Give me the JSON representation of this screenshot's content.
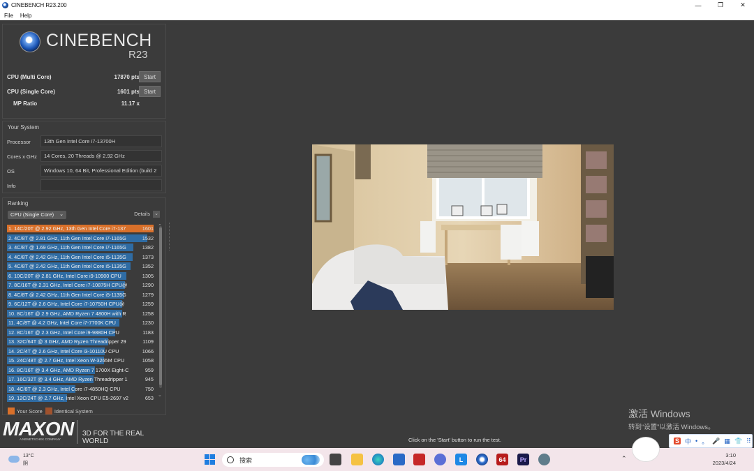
{
  "window": {
    "title": "CINEBENCH R23.200",
    "min": "—",
    "max": "❐",
    "close": "✕"
  },
  "menu": [
    "File",
    "Help"
  ],
  "logo": {
    "name": "CINEBENCH",
    "version": "R23"
  },
  "scores": {
    "multi": {
      "label": "CPU (Multi Core)",
      "value": "17870 pts",
      "button": "Start"
    },
    "single": {
      "label": "CPU (Single Core)",
      "value": "1601 pts",
      "button": "Start"
    },
    "mp": {
      "label": "MP Ratio",
      "value": "11.17 x"
    }
  },
  "system": {
    "title": "Your System",
    "rows": [
      {
        "key": "Processor",
        "value": "13th Gen Intel Core i7-13700H"
      },
      {
        "key": "Cores x GHz",
        "value": "14 Cores, 20 Threads @ 2.92 GHz"
      },
      {
        "key": "OS",
        "value": "Windows 10, 64 Bit, Professional Edition (build 2"
      },
      {
        "key": "Info",
        "value": ""
      }
    ]
  },
  "ranking": {
    "title": "Ranking",
    "select": "CPU (Single Core)",
    "details": "Details",
    "max_score": 1601,
    "items": [
      {
        "label": "1. 14C/20T @ 2.92 GHz, 13th Gen Intel Core i7-137",
        "score": 1601,
        "mine": true
      },
      {
        "label": "2. 4C/8T @ 2.81 GHz, 11th Gen Intel Core i7-1165G",
        "score": 1532,
        "mine": false
      },
      {
        "label": "3. 4C/8T @ 1.69 GHz, 11th Gen Intel Core i7-1165G",
        "score": 1382,
        "mine": false
      },
      {
        "label": "4. 4C/8T @ 2.42 GHz, 11th Gen Intel Core i5-1135G",
        "score": 1373,
        "mine": false
      },
      {
        "label": "5. 4C/8T @ 2.42 GHz, 11th Gen Intel Core i5-1135G",
        "score": 1352,
        "mine": false
      },
      {
        "label": "6. 10C/20T @ 2.81 GHz, Intel Core i9-10900 CPU",
        "score": 1305,
        "mine": false
      },
      {
        "label": "7. 8C/16T @ 2.31 GHz, Intel Core i7-10875H CPU@",
        "score": 1290,
        "mine": false
      },
      {
        "label": "8. 4C/8T @ 2.42 GHz, 11th Gen Intel Core i5-1135G",
        "score": 1279,
        "mine": false
      },
      {
        "label": "9. 6C/12T @ 2.6 GHz, Intel Core i7-10750H CPU@",
        "score": 1259,
        "mine": false
      },
      {
        "label": "10. 8C/16T @ 2.9 GHz, AMD Ryzen 7 4800H with R",
        "score": 1258,
        "mine": false
      },
      {
        "label": "11. 4C/8T @ 4.2 GHz, Intel Core i7-7700K CPU",
        "score": 1230,
        "mine": false
      },
      {
        "label": "12. 8C/16T @ 2.3 GHz, Intel Core i9-9880H CPU",
        "score": 1183,
        "mine": false
      },
      {
        "label": "13. 32C/64T @ 3 GHz, AMD Ryzen Threadripper 29",
        "score": 1109,
        "mine": false
      },
      {
        "label": "14. 2C/4T @ 2.6 GHz, Intel Core i3-10110U CPU",
        "score": 1066,
        "mine": false
      },
      {
        "label": "15. 24C/48T @ 2.7 GHz, Intel Xeon W-3265M CPU",
        "score": 1058,
        "mine": false
      },
      {
        "label": "16. 8C/16T @ 3.4 GHz, AMD Ryzen 7 1700X Eight-C",
        "score": 959,
        "mine": false
      },
      {
        "label": "17. 16C/32T @ 3.4 GHz, AMD Ryzen Threadripper 1",
        "score": 945,
        "mine": false
      },
      {
        "label": "18. 4C/8T @ 2.3 GHz, Intel Core i7-4850HQ CPU",
        "score": 750,
        "mine": false
      },
      {
        "label": "19. 12C/24T @ 2.7 GHz, Intel Xeon CPU E5-2697 v2",
        "score": 653,
        "mine": false
      }
    ],
    "legend": {
      "yours": "Your Score",
      "identical": "Identical System",
      "yours_color": "#d9702a",
      "identical_color": "#a0522d"
    }
  },
  "footer": {
    "brand": "MAXON",
    "sub": "A NEMETSCHEK COMPANY",
    "slogan": "3D FOR THE REAL WORLD"
  },
  "hint": "Click on the 'Start' button to run the test.",
  "watermark": {
    "line1": "激活 Windows",
    "line2": "转到“设置”以激活 Windows。"
  },
  "taskbar": {
    "weather": {
      "temp": "13°C",
      "cond": "阴"
    },
    "search": "搜索",
    "date": "2023/4/24",
    "time": "3:10",
    "ime": [
      "S",
      "中",
      "•",
      "。",
      "🎤",
      "▦",
      "👕",
      "⠿"
    ]
  },
  "colors": {
    "accent": "#d9702a",
    "bar": "#2f6ca4",
    "bg": "#3b3b3b"
  }
}
